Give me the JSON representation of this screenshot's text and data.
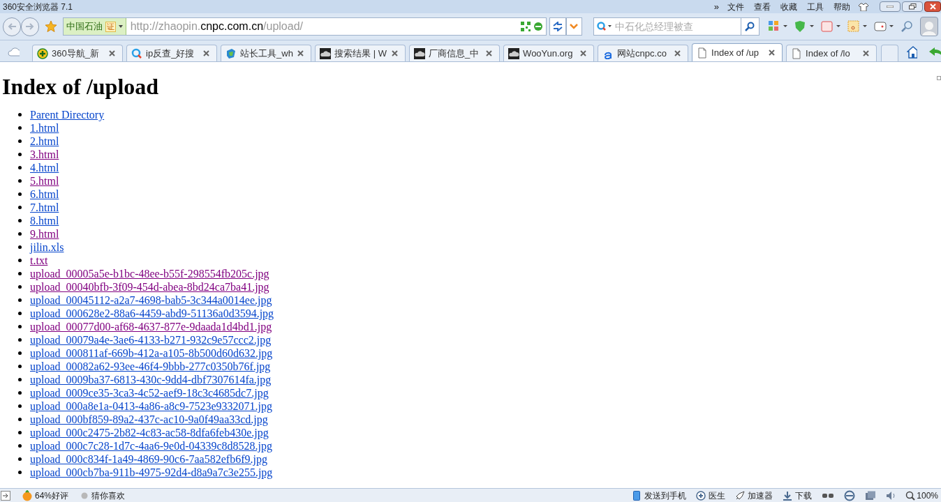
{
  "window": {
    "title": "360安全浏览器 7.1"
  },
  "menu_overflow": "»",
  "menu": [
    "文件",
    "查看",
    "收藏",
    "工具",
    "帮助"
  ],
  "address": {
    "site_label": "中国石油",
    "cert_badge": "证",
    "url_host_prefix": "http://zhaopin.",
    "url_host": "cnpc.com.cn",
    "url_path": "/upload/"
  },
  "search": {
    "placeholder": "中石化总经理被查"
  },
  "tabs": [
    {
      "kind": "plus",
      "label": "360导航_新",
      "selected": false
    },
    {
      "kind": "search",
      "label": "ip反查_好搜",
      "selected": false
    },
    {
      "kind": "tools",
      "label": "站长工具_wh",
      "selected": false
    },
    {
      "kind": "cloud",
      "label": "搜索结果 | W",
      "selected": false
    },
    {
      "kind": "cloud",
      "label": "厂商信息_中",
      "selected": false
    },
    {
      "kind": "cloud",
      "label": "WooYun.org",
      "selected": false
    },
    {
      "kind": "letter",
      "label": "网站cnpc.co",
      "selected": false
    },
    {
      "kind": "page",
      "label": "Index of /up",
      "selected": true
    },
    {
      "kind": "page",
      "label": "Index of /lo",
      "selected": false
    }
  ],
  "page": {
    "heading": "Index of /upload",
    "links": [
      {
        "text": "Parent Directory",
        "visited": false
      },
      {
        "text": "1.html",
        "visited": false
      },
      {
        "text": "2.html",
        "visited": false
      },
      {
        "text": "3.html",
        "visited": true
      },
      {
        "text": "4.html",
        "visited": false
      },
      {
        "text": "5.html",
        "visited": true
      },
      {
        "text": "6.html",
        "visited": false
      },
      {
        "text": "7.html",
        "visited": false
      },
      {
        "text": "8.html",
        "visited": false
      },
      {
        "text": "9.html",
        "visited": true
      },
      {
        "text": "jilin.xls",
        "visited": false
      },
      {
        "text": "t.txt",
        "visited": true
      },
      {
        "text": "upload_00005a5e-b1bc-48ee-b55f-298554fb205c.jpg",
        "visited": true
      },
      {
        "text": "upload_00040bfb-3f09-454d-abea-8bd24ca7ba41.jpg",
        "visited": true
      },
      {
        "text": "upload_00045112-a2a7-4698-bab5-3c344a0014ee.jpg",
        "visited": false
      },
      {
        "text": "upload_000628e2-88a6-4459-abd9-51136a0d3594.jpg",
        "visited": false
      },
      {
        "text": "upload_00077d00-af68-4637-877e-9daada1d4bd1.jpg",
        "visited": true
      },
      {
        "text": "upload_00079a4e-3ae6-4133-b271-932c9e57ccc2.jpg",
        "visited": false
      },
      {
        "text": "upload_000811af-669b-412a-a105-8b500d60d632.jpg",
        "visited": false
      },
      {
        "text": "upload_00082a62-93ee-46f4-9bbb-277c0350b76f.jpg",
        "visited": false
      },
      {
        "text": "upload_0009ba37-6813-430c-9dd4-dbf7307614fa.jpg",
        "visited": false
      },
      {
        "text": "upload_0009ce35-3ca3-4c52-aef9-18c3c4685dc7.jpg",
        "visited": false
      },
      {
        "text": "upload_000a8e1a-0413-4a86-a8c9-7523e9332071.jpg",
        "visited": false
      },
      {
        "text": "upload_000bf859-89a2-437c-ac10-9a0f49aa33cd.jpg",
        "visited": false
      },
      {
        "text": "upload_000c2475-2b82-4c83-ac58-8dfa6feb430e.jpg",
        "visited": false
      },
      {
        "text": "upload_000c7c28-1d7c-4aa6-9e0d-04339c8d8528.jpg",
        "visited": false
      },
      {
        "text": "upload_000c834f-1a49-4869-90c6-7aa582efb6f9.jpg",
        "visited": false
      },
      {
        "text": "upload_000cb7ba-911b-4975-92d4-d8a9a7c3e255.jpg",
        "visited": false
      }
    ]
  },
  "status_bar": {
    "left": [
      "64%好评",
      "猜你喜欢"
    ],
    "right": [
      "发送到手机",
      "医生",
      "加速器",
      "下载"
    ],
    "zoom": "100%"
  }
}
